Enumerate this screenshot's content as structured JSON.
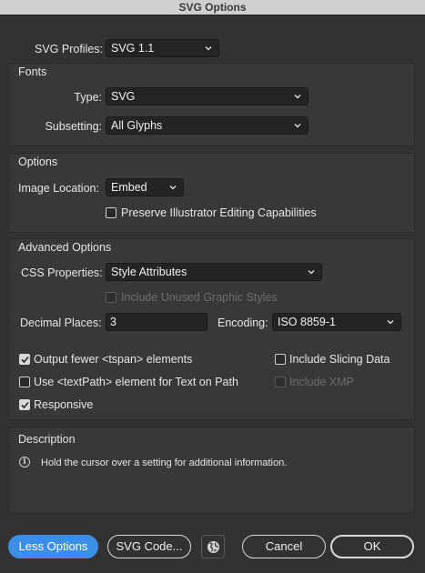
{
  "window": {
    "title": "SVG Options"
  },
  "svg_profiles": {
    "label": "SVG Profiles:",
    "value": "SVG 1.1"
  },
  "fonts": {
    "title": "Fonts",
    "type_label": "Type:",
    "type_value": "SVG",
    "subsetting_label": "Subsetting:",
    "subsetting_value": "All Glyphs"
  },
  "options": {
    "title": "Options",
    "image_location_label": "Image Location:",
    "image_location_value": "Embed",
    "preserve_label": "Preserve Illustrator Editing Capabilities",
    "preserve_checked": false
  },
  "advanced": {
    "title": "Advanced Options",
    "css_label": "CSS Properties:",
    "css_value": "Style Attributes",
    "include_unused_label": "Include Unused Graphic Styles",
    "decimal_label": "Decimal Places:",
    "decimal_value": "3",
    "encoding_label": "Encoding:",
    "encoding_value": "ISO 8859-1",
    "output_fewer_label": "Output fewer <tspan> elements",
    "output_fewer_checked": true,
    "include_slicing_label": "Include Slicing Data",
    "include_slicing_checked": false,
    "textpath_label": "Use <textPath> element for Text on Path",
    "textpath_checked": false,
    "include_xmp_label": "Include XMP",
    "responsive_label": "Responsive",
    "responsive_checked": true
  },
  "description": {
    "title": "Description",
    "text": "Hold the cursor over a setting for additional information."
  },
  "buttons": {
    "less_options": "Less Options",
    "svg_code": "SVG Code...",
    "cancel": "Cancel",
    "ok": "OK"
  },
  "colors": {
    "accent": "#3d8ee6",
    "background": "#323232"
  },
  "icons": {
    "globe": "globe-icon",
    "info": "info-icon",
    "chevron": "chevron-down-icon",
    "check": "checkmark-icon"
  }
}
